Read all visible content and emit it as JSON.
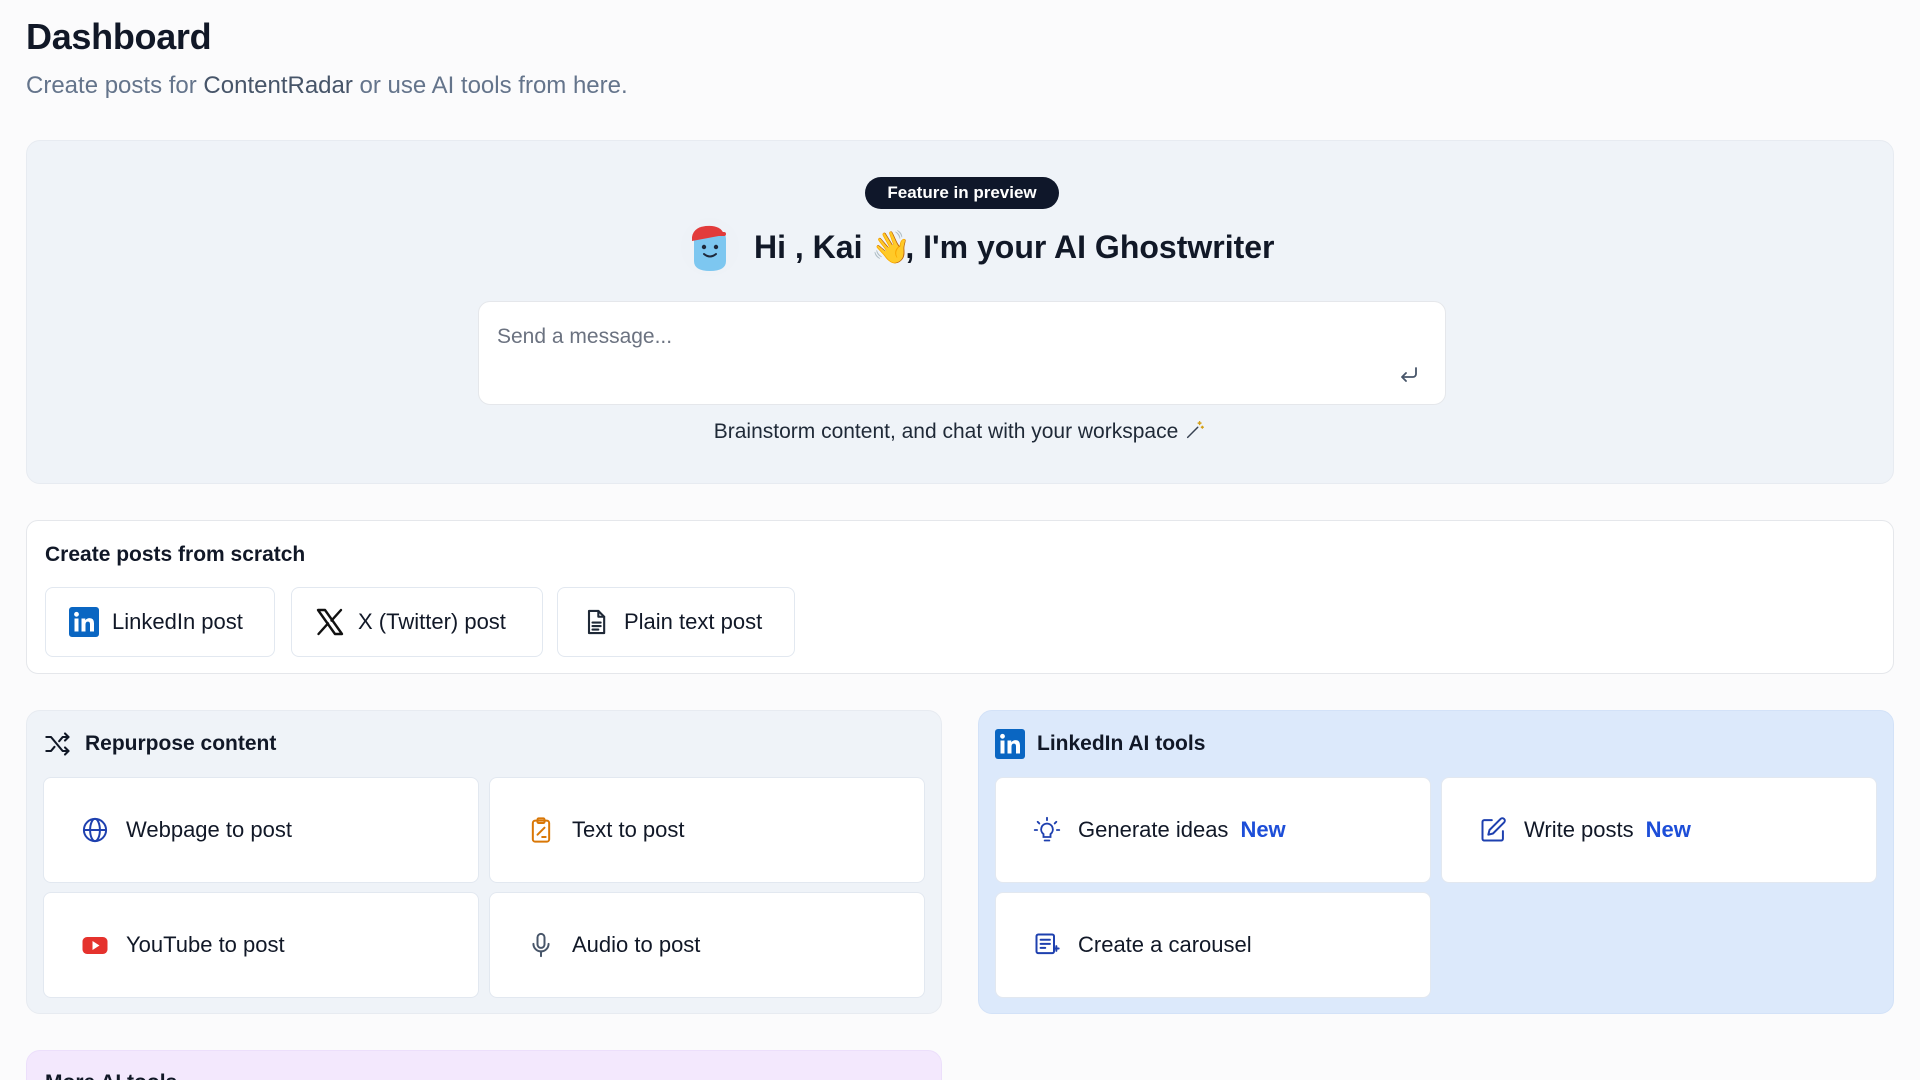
{
  "header": {
    "title": "Dashboard",
    "subtitle_prefix": "Create posts for ",
    "subtitle_brand": "ContentRadar",
    "subtitle_suffix": " or use AI tools from here."
  },
  "hero": {
    "badge": "Feature in preview",
    "greeting_prefix": "Hi , Kai ",
    "greeting_emoji": "👋",
    "greeting_suffix": ", I'm your AI Ghostwriter",
    "message_placeholder": "Send a message...",
    "hint": "Brainstorm content, and chat with your workspace"
  },
  "scratch": {
    "title": "Create posts from scratch",
    "buttons": [
      {
        "label": "LinkedIn post",
        "icon": "linkedin-icon"
      },
      {
        "label": "X (Twitter) post",
        "icon": "x-icon"
      },
      {
        "label": "Plain text post",
        "icon": "document-icon"
      }
    ]
  },
  "repurpose": {
    "title": "Repurpose content",
    "icon": "shuffle-icon",
    "tools": [
      {
        "label": "Webpage to post",
        "icon": "globe-icon"
      },
      {
        "label": "Text to post",
        "icon": "clipboard-icon"
      },
      {
        "label": "YouTube to post",
        "icon": "youtube-icon"
      },
      {
        "label": "Audio to post",
        "icon": "microphone-icon"
      }
    ]
  },
  "linkedin_tools": {
    "title": "LinkedIn AI tools",
    "icon": "linkedin-icon",
    "tools": [
      {
        "label": "Generate ideas",
        "badge": "New",
        "icon": "lightbulb-icon"
      },
      {
        "label": "Write posts",
        "badge": "New",
        "icon": "edit-icon"
      },
      {
        "label": "Create a carousel",
        "icon": "carousel-icon"
      }
    ]
  },
  "more_tools": {
    "title": "More AI tools"
  },
  "colors": {
    "linkedin": "#0a66c2",
    "youtube": "#e5322d",
    "new_badge": "#1d4ed8",
    "text_to_post_icon": "#d97706",
    "hero_bg": "#eff3f8",
    "linkedin_card_bg": "#dce9fb",
    "more_card_bg": "#f3e8fd"
  }
}
